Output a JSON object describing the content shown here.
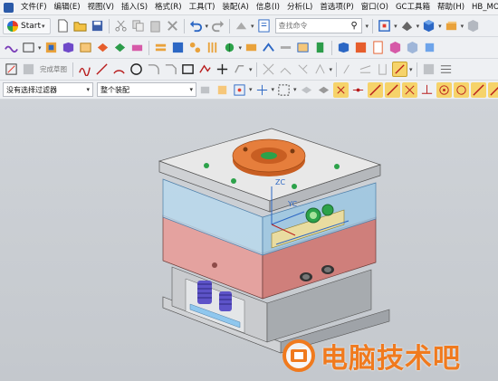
{
  "menubar": {
    "items": [
      "文件(F)",
      "编辑(E)",
      "视图(V)",
      "插入(S)",
      "格式(R)",
      "工具(T)",
      "装配(A)",
      "信息(I)",
      "分析(L)",
      "首选项(P)",
      "窗口(O)",
      "GC工具箱",
      "帮助(H)",
      "HB_MOULI"
    ]
  },
  "toolbar1": {
    "start_label": "Start",
    "search_placeholder": "查找命令"
  },
  "toolbar3": {
    "sketch_label": "完成草图"
  },
  "toolbar4": {
    "filter_value": "没有选择过滤器",
    "assembly_value": "整个装配"
  },
  "viewport": {
    "axis_z": "ZC",
    "axis_y": "YC",
    "colors": {
      "plate_top": "#e8e8e8",
      "plate_side": "#bfc2c6",
      "cavity_glass": "#b8d8ec",
      "core_block": "#d98a86",
      "locating_ring": "#e67e3c",
      "spring": "#5d53c8",
      "ejector": "#8fc7ee"
    }
  },
  "watermark": {
    "text": "电脑技术吧"
  }
}
